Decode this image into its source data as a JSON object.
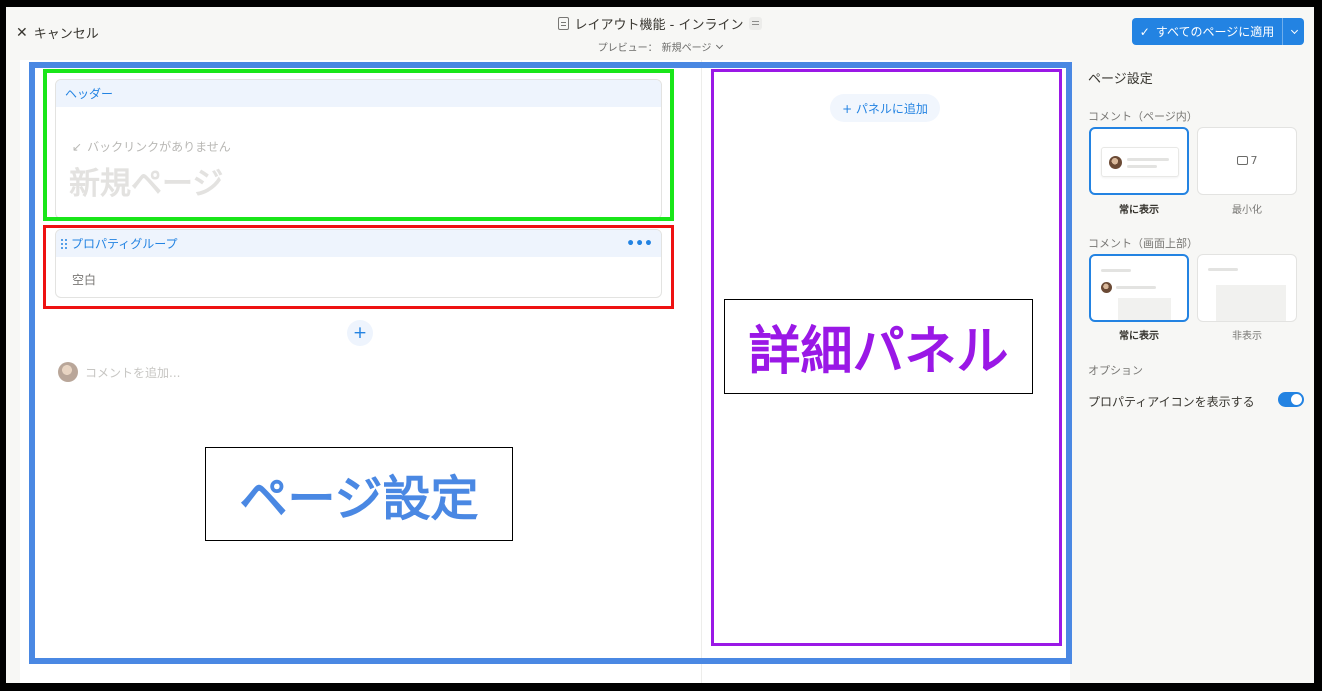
{
  "topbar": {
    "cancel_icon": "close-icon",
    "cancel_label": "キャンセル",
    "title": "レイアウト機能 - インライン",
    "preview_label": "プレビュー：",
    "preview_page": "新規ページ",
    "apply_label": "すべてのページに適用",
    "apply_check": "✓"
  },
  "canvas": {
    "header_card_label": "ヘッダー",
    "backlink_icon": "↙",
    "backlink_text": "バックリンクがありません",
    "page_title": "新規ページ",
    "property_group_label": "プロパティグループ",
    "property_group_more": "•••",
    "property_empty": "空白",
    "add_block": "+",
    "comment_placeholder": "コメントを追加...",
    "panel_add_label": "+ パネルに追加"
  },
  "sidebar": {
    "title": "ページ設定",
    "comments_inline_label": "コメント（ページ内）",
    "comments_inline_options": [
      {
        "label": "常に表示",
        "selected": true
      },
      {
        "label": "最小化",
        "selected": false,
        "count": "7"
      }
    ],
    "comments_top_label": "コメント（画面上部）",
    "comments_top_options": [
      {
        "label": "常に表示",
        "selected": true
      },
      {
        "label": "非表示",
        "selected": false
      }
    ],
    "options_label": "オプション",
    "show_property_icons_label": "プロパティアイコンを表示する",
    "show_property_icons": true
  },
  "annotations": {
    "page_settings": "ページ設定",
    "details_panel": "詳細パネル"
  },
  "colors": {
    "accent": "#2383e2",
    "annotation_blue": "#4a88e3",
    "annotation_green": "#19e619",
    "annotation_red": "#ee1111",
    "annotation_purple": "#9a18e6"
  }
}
